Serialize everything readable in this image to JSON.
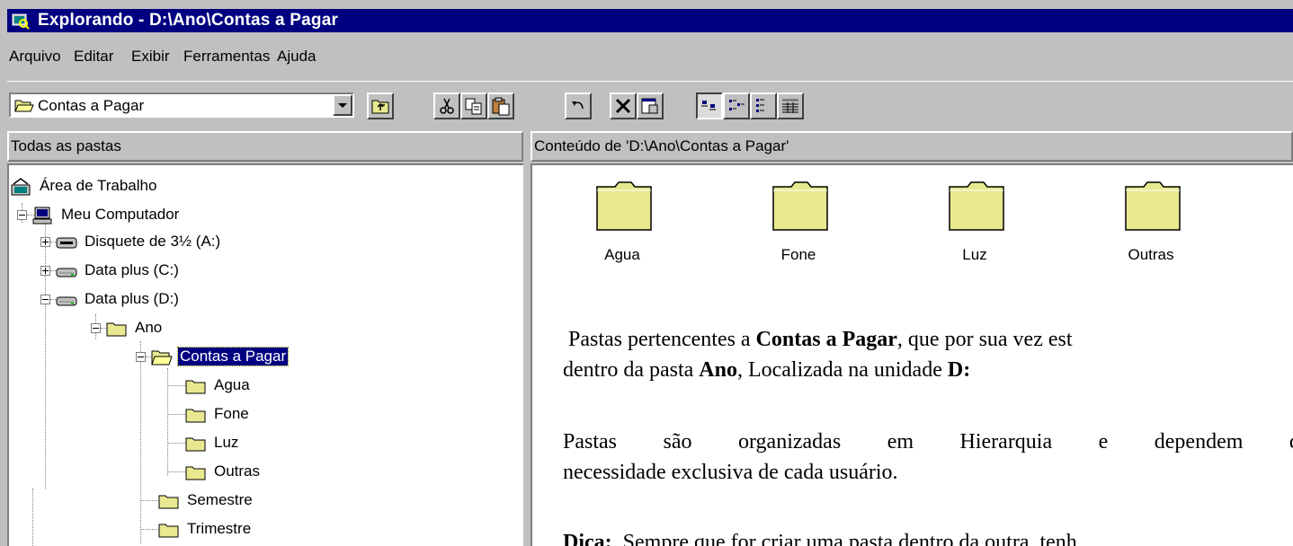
{
  "window": {
    "title": "Explorando - D:\\Ano\\Contas a Pagar"
  },
  "menu": {
    "items": [
      {
        "label": "Arquivo"
      },
      {
        "label": "Editar"
      },
      {
        "label": "Exibir"
      },
      {
        "label": "Ferramentas"
      },
      {
        "label": "Ajuda"
      }
    ]
  },
  "toolbar": {
    "address_value": "Contas a Pagar",
    "buttons": [
      {
        "icon": "up-folder-icon"
      },
      {
        "icon": "cut-icon"
      },
      {
        "icon": "copy-icon"
      },
      {
        "icon": "paste-icon"
      },
      {
        "icon": "undo-icon"
      },
      {
        "icon": "delete-icon"
      },
      {
        "icon": "properties-icon"
      },
      {
        "icon": "large-icons-view-icon"
      },
      {
        "icon": "small-icons-view-icon"
      },
      {
        "icon": "list-view-icon"
      },
      {
        "icon": "details-view-icon"
      }
    ]
  },
  "tree": {
    "header": "Todas as pastas",
    "nodes": [
      {
        "label": "Área de Trabalho",
        "icon": "desktop-icon"
      },
      {
        "label": "Meu Computador",
        "icon": "computer-icon",
        "expander": "minus"
      },
      {
        "label": "Disquete de 3½ (A:)",
        "icon": "floppy-drive-icon",
        "expander": "plus"
      },
      {
        "label": "Data plus (C:)",
        "icon": "hard-drive-icon",
        "expander": "plus"
      },
      {
        "label": "Data plus (D:)",
        "icon": "hard-drive-icon",
        "expander": "minus"
      },
      {
        "label": "Ano",
        "icon": "folder-icon",
        "expander": "minus"
      },
      {
        "label": "Contas a Pagar",
        "icon": "open-folder-icon",
        "expander": "minus",
        "selected": true
      },
      {
        "label": "Agua",
        "icon": "folder-icon"
      },
      {
        "label": "Fone",
        "icon": "folder-icon"
      },
      {
        "label": "Luz",
        "icon": "folder-icon"
      },
      {
        "label": "Outras",
        "icon": "folder-icon"
      },
      {
        "label": "Semestre",
        "icon": "folder-icon"
      },
      {
        "label": "Trimestre",
        "icon": "folder-icon"
      }
    ]
  },
  "content": {
    "header": "Conteúdo de 'D:\\Ano\\Contas a Pagar'",
    "folders": [
      "Agua",
      "Fone",
      "Luz",
      "Outras"
    ],
    "note1": {
      "a": "Pastas pertencentes a ",
      "b": "Contas a Pagar",
      "c": ", que por sua vez est",
      "d": "dentro da pasta ",
      "e": "Ano",
      "f": ", Localizada na unidade ",
      "g": "D:"
    },
    "note2": {
      "line1_w": [
        "Pastas",
        "são",
        "organizadas",
        "em",
        "Hierarquia",
        "e",
        "dependem",
        "d"
      ],
      "line2": "necessidade exclusiva de cada usuário."
    },
    "note3": {
      "bold": "Dica:",
      "text": "  Sempre que for criar uma pasta dentro da outra, tenh"
    }
  },
  "colors": {
    "titlebar": "#000080",
    "face": "#c0c0c0",
    "folder": "#e8e890",
    "selection": "#000080"
  }
}
